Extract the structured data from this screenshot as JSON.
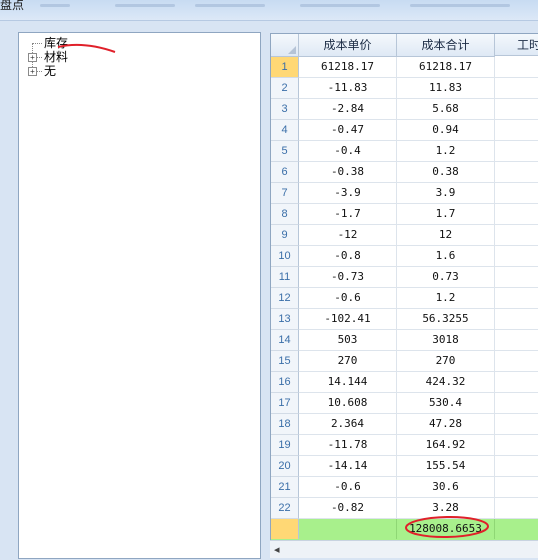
{
  "window": {
    "title": "盘点"
  },
  "tree": {
    "nodes": [
      {
        "label": "库存",
        "expandable": false
      },
      {
        "label": "材料",
        "expandable": true,
        "expander": "+"
      },
      {
        "label": "无",
        "expandable": true,
        "expander": "+"
      }
    ]
  },
  "grid": {
    "columns": [
      "成本单价",
      "成本合计",
      "工时"
    ],
    "rows": [
      {
        "n": "1",
        "price": "61218.17",
        "total": "61218.17"
      },
      {
        "n": "2",
        "price": "-11.83",
        "total": "11.83"
      },
      {
        "n": "3",
        "price": "-2.84",
        "total": "5.68"
      },
      {
        "n": "4",
        "price": "-0.47",
        "total": "0.94"
      },
      {
        "n": "5",
        "price": "-0.4",
        "total": "1.2"
      },
      {
        "n": "6",
        "price": "-0.38",
        "total": "0.38"
      },
      {
        "n": "7",
        "price": "-3.9",
        "total": "3.9"
      },
      {
        "n": "8",
        "price": "-1.7",
        "total": "1.7"
      },
      {
        "n": "9",
        "price": "-12",
        "total": "12"
      },
      {
        "n": "10",
        "price": "-0.8",
        "total": "1.6"
      },
      {
        "n": "11",
        "price": "-0.73",
        "total": "0.73"
      },
      {
        "n": "12",
        "price": "-0.6",
        "total": "1.2"
      },
      {
        "n": "13",
        "price": "-102.41",
        "total": "56.3255"
      },
      {
        "n": "14",
        "price": "503",
        "total": "3018"
      },
      {
        "n": "15",
        "price": "270",
        "total": "270"
      },
      {
        "n": "16",
        "price": "14.144",
        "total": "424.32"
      },
      {
        "n": "17",
        "price": "10.608",
        "total": "530.4"
      },
      {
        "n": "18",
        "price": "2.364",
        "total": "47.28"
      },
      {
        "n": "19",
        "price": "-11.78",
        "total": "164.92"
      },
      {
        "n": "20",
        "price": "-14.14",
        "total": "155.54"
      },
      {
        "n": "21",
        "price": "-0.6",
        "total": "30.6"
      },
      {
        "n": "22",
        "price": "-0.82",
        "total": "3.28"
      }
    ],
    "footer": {
      "total": "128008.6653"
    },
    "selected_row": "1",
    "scroll_left_icon": "◂"
  },
  "colors": {
    "footer_bg": "#a8f08c",
    "selected_rownum_bg": "#ffd875",
    "annotation_red": "#e0202a"
  }
}
